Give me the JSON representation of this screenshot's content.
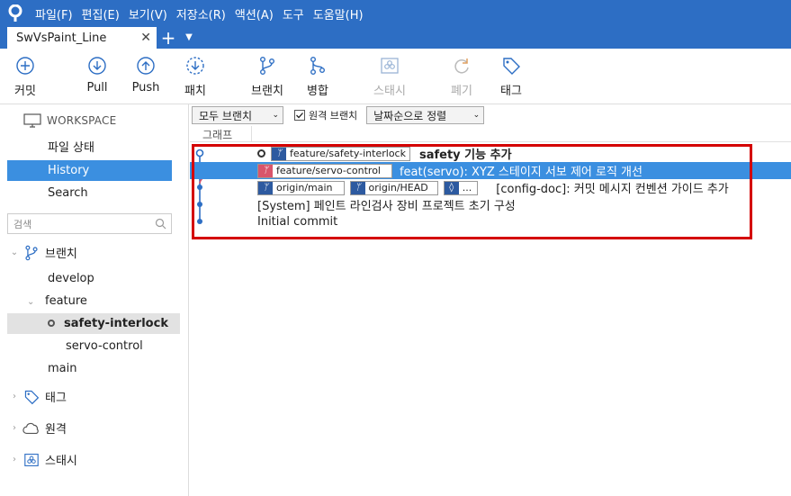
{
  "menubar": {
    "items": [
      "파일(F)",
      "편집(E)",
      "보기(V)",
      "저장소(R)",
      "액션(A)",
      "도구",
      "도움말(H)"
    ]
  },
  "tabs": [
    {
      "label": "SwVsPaint_Line",
      "close": "✕"
    }
  ],
  "toolbar": {
    "commit": "커밋",
    "pull": "Pull",
    "push": "Push",
    "fetch": "패치",
    "branch": "브랜치",
    "merge": "병합",
    "stash": "스태시",
    "discard": "폐기",
    "tag": "태그"
  },
  "sidebar": {
    "workspace": "WORKSPACE",
    "file_status": "파일 상태",
    "history": "History",
    "search": "Search",
    "search_placeholder": "검색",
    "branches_label": "브랜치",
    "branches": {
      "develop": "develop",
      "feature": "feature",
      "safety": "safety-interlock",
      "servo": "servo-control",
      "main": "main"
    },
    "tags_label": "태그",
    "remotes_label": "원격",
    "stashes_label": "스태시"
  },
  "filters": {
    "branch_filter": "모두 브랜치",
    "remote_branches": "원격 브랜치",
    "sort": "날짜순으로 정렬"
  },
  "graph_header": "그래프",
  "commits": [
    {
      "refs": [
        {
          "label": "feature/safety-interlock",
          "kind": "branch"
        }
      ],
      "message": "safety 기능 추가",
      "bold": true
    },
    {
      "refs": [
        {
          "label": "feature/servo-control",
          "kind": "branch-red"
        }
      ],
      "message": "feat(servo): XYZ 스테이지 서보 제어 로직 개선"
    },
    {
      "refs": [
        {
          "label": "origin/main",
          "kind": "branch"
        },
        {
          "label": "origin/HEAD",
          "kind": "branch"
        },
        {
          "label": "...",
          "kind": "tag"
        }
      ],
      "message": "[config-doc]: 커밋 메시지 컨벤션 가이드 추가"
    },
    {
      "refs": [],
      "message": "[System] 페인트 라인검사 장비 프로젝트 초기 구성"
    },
    {
      "refs": [],
      "message": "Initial commit"
    }
  ],
  "colors": {
    "brand": "#2d6ec4",
    "selection": "#3b8fe0",
    "highlight_box": "#d40000",
    "graph_blue": "#2d6ec4",
    "graph_red": "#d9556b"
  }
}
